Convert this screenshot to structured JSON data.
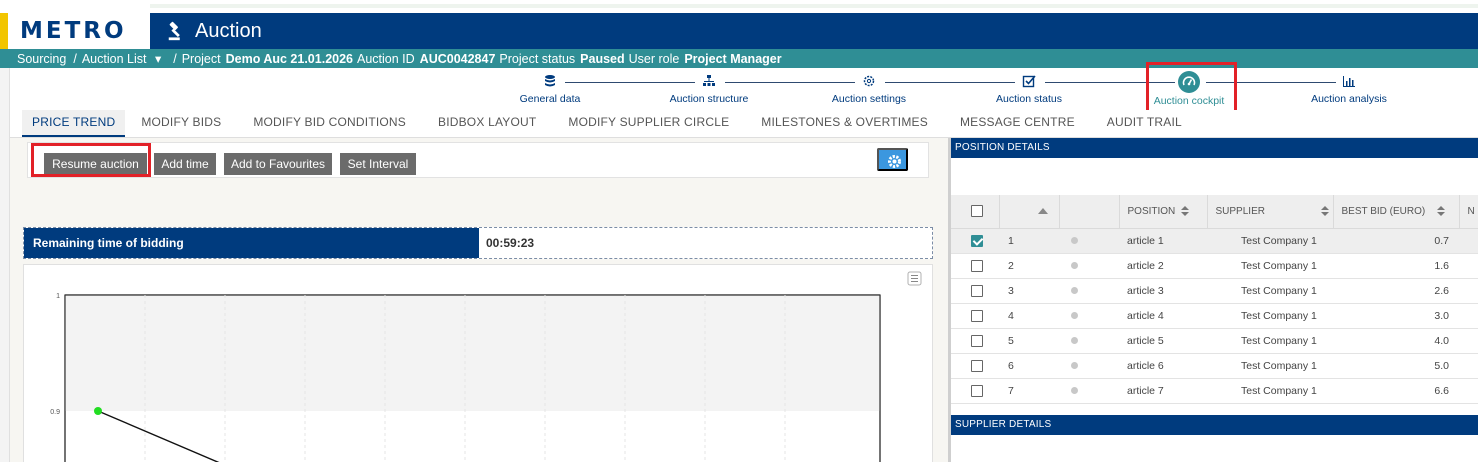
{
  "header": {
    "logo_text": "METRO",
    "app_title": "Auction",
    "brand_color": "#003b7e",
    "accent_color": "#2f8e95"
  },
  "breadcrumb": {
    "sourcing": "Sourcing",
    "sep": "/",
    "auction_list": "Auction List",
    "project_label": "Project",
    "project_value": "Demo Auc 21.01.2026",
    "auction_id_label": "Auction ID",
    "auction_id_value": "AUC0042847",
    "status_label": "Project status",
    "status_value": "Paused",
    "role_label": "User role",
    "role_value": "Project Manager"
  },
  "stepper": {
    "steps": [
      {
        "label": "General data",
        "icon": "database-icon"
      },
      {
        "label": "Auction structure",
        "icon": "sitemap-icon"
      },
      {
        "label": "Auction settings",
        "icon": "gear-icon"
      },
      {
        "label": "Auction status",
        "icon": "check-square-icon"
      },
      {
        "label": "Auction cockpit",
        "icon": "dashboard-icon",
        "active": true
      },
      {
        "label": "Auction analysis",
        "icon": "bar-chart-icon"
      }
    ]
  },
  "tabs": [
    "PRICE TREND",
    "MODIFY BIDS",
    "MODIFY BID CONDITIONS",
    "BIDBOX LAYOUT",
    "MODIFY SUPPLIER CIRCLE",
    "MILESTONES & OVERTIMES",
    "MESSAGE CENTRE",
    "AUDIT TRAIL"
  ],
  "toolbar": {
    "resume": "Resume auction",
    "add_time": "Add time",
    "add_fav": "Add to Favourites",
    "set_interval": "Set Interval"
  },
  "remaining": {
    "label": "Remaining time of bidding",
    "value": "00:59:23"
  },
  "chart_data": {
    "type": "line",
    "title": "",
    "xlabel": "",
    "ylabel": "",
    "y_ticks": [
      "1",
      "0.9"
    ],
    "series": [
      {
        "values": [
          0.9,
          0.85
        ]
      }
    ],
    "point_color": "#22dd22"
  },
  "position_details": {
    "title": "POSITION DETAILS",
    "columns": [
      "POSITION",
      "SUPPLIER",
      "BEST BID (EURO)",
      "N"
    ],
    "rows": [
      {
        "num": "1",
        "position": "article 1",
        "supplier": "Test Company 1",
        "bid": "0.7",
        "checked": true
      },
      {
        "num": "2",
        "position": "article 2",
        "supplier": "Test Company 1",
        "bid": "1.6",
        "checked": false
      },
      {
        "num": "3",
        "position": "article 3",
        "supplier": "Test Company 1",
        "bid": "2.6",
        "checked": false
      },
      {
        "num": "4",
        "position": "article 4",
        "supplier": "Test Company 1",
        "bid": "3.0",
        "checked": false
      },
      {
        "num": "5",
        "position": "article 5",
        "supplier": "Test Company 1",
        "bid": "4.0",
        "checked": false
      },
      {
        "num": "6",
        "position": "article 6",
        "supplier": "Test Company 1",
        "bid": "5.0",
        "checked": false
      },
      {
        "num": "7",
        "position": "article 7",
        "supplier": "Test Company 1",
        "bid": "6.6",
        "checked": false
      }
    ]
  },
  "supplier_details": {
    "title": "SUPPLIER DETAILS"
  }
}
